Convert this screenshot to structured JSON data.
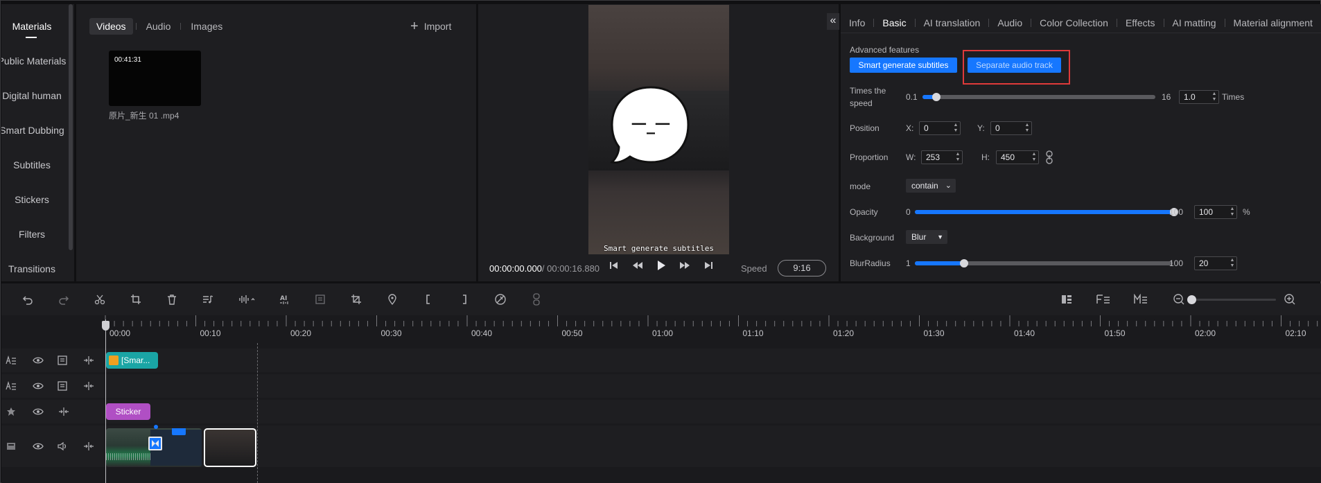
{
  "left_nav": {
    "items": [
      "Materials",
      "Public Materials",
      "Digital human",
      "Smart Dubbing",
      "Subtitles",
      "Stickers",
      "Filters",
      "Transitions"
    ]
  },
  "media": {
    "tabs": [
      "Videos",
      "Audio",
      "Images"
    ],
    "import_label": "Import",
    "item": {
      "duration": "00:41:31",
      "name": "原片_新生 01 .mp4"
    }
  },
  "player": {
    "subtitle_text": "Smart generate subtitles",
    "sticker_text": "ㅡ_ㅡ",
    "current_time": "00:00:00.000",
    "total_time": "/ 00:00:16.880",
    "speed_label": "Speed",
    "aspect_ratio": "9:16"
  },
  "props": {
    "collapse_icon": "«",
    "tabs": [
      "Info",
      "Basic",
      "AI translation",
      "Audio",
      "Color Collection",
      "Effects",
      "AI matting",
      "Material alignment"
    ],
    "advanced_label": "Advanced features",
    "smart_subtitles_btn": "Smart generate subtitles",
    "separate_audio_btn": "Separate audio track",
    "speed": {
      "label_line1": "Times the",
      "label_line2": "speed",
      "min": "0.1",
      "max": "16",
      "value": "1.0",
      "unit": "Times",
      "fraction": 0.06
    },
    "position": {
      "label": "Position",
      "x_label": "X:",
      "x_value": "0",
      "y_label": "Y:",
      "y_value": "0"
    },
    "proportion": {
      "label": "Proportion",
      "w_label": "W:",
      "w_value": "253",
      "h_label": "H:",
      "h_value": "450"
    },
    "mode": {
      "label": "mode",
      "value": "contain"
    },
    "opacity": {
      "label": "Opacity",
      "min": "0",
      "max": "100",
      "value": "100",
      "unit": "%",
      "fraction": 1.0
    },
    "background": {
      "label": "Background",
      "value": "Blur"
    },
    "blur_radius": {
      "label": "BlurRadius",
      "min": "1",
      "max": "100",
      "value": "20",
      "fraction": 0.19
    }
  },
  "timeline": {
    "ruler_labels": [
      "00:00",
      "00:10",
      "00:20",
      "00:30",
      "00:40",
      "00:50",
      "01:00",
      "01:10",
      "01:20",
      "01:30",
      "01:40",
      "01:50",
      "02:00",
      "02:10"
    ],
    "clips": {
      "subtitle_clip": "[Smar...",
      "sticker_clip": "Sticker"
    }
  },
  "colors": {
    "accent": "#1677ff",
    "subtitle_clip": "#1aa5a5",
    "sticker_clip": "#b04fc4",
    "highlight_box": "#e03a3a"
  }
}
